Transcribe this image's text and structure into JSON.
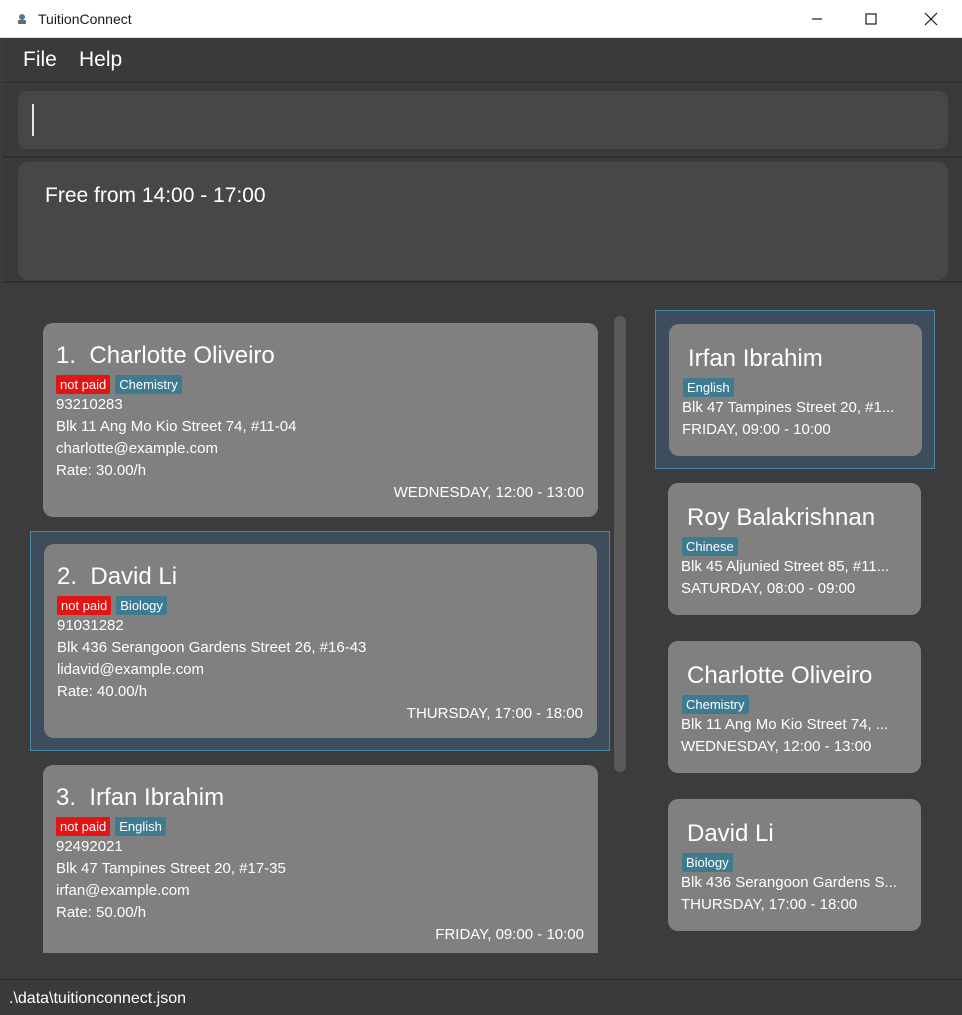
{
  "window": {
    "title": "TuitionConnect"
  },
  "menu": {
    "file": "File",
    "help": "Help"
  },
  "command": {
    "value": ""
  },
  "result": {
    "text": "Free from 14:00 - 17:00"
  },
  "students": [
    {
      "index": "1.",
      "name": "Charlotte Oliveiro",
      "paid": "not paid",
      "subject": "Chemistry",
      "phone": "93210283",
      "address": "Blk 11 Ang Mo Kio Street 74, #11-04",
      "email": "charlotte@example.com",
      "rate": "Rate: 30.00/h",
      "lesson": "WEDNESDAY, 12:00 - 13:00"
    },
    {
      "index": "2.",
      "name": "David Li",
      "paid": "not paid",
      "subject": "Biology",
      "phone": "91031282",
      "address": "Blk 436 Serangoon Gardens Street 26, #16-43",
      "email": "lidavid@example.com",
      "rate": "Rate: 40.00/h",
      "lesson": "THURSDAY, 17:00 - 18:00"
    },
    {
      "index": "3.",
      "name": "Irfan Ibrahim",
      "paid": "not paid",
      "subject": "English",
      "phone": "92492021",
      "address": "Blk 47 Tampines Street 20, #17-35",
      "email": "irfan@example.com",
      "rate": "Rate: 50.00/h",
      "lesson": "FRIDAY, 09:00 - 10:00"
    }
  ],
  "schedule": [
    {
      "name": "Irfan Ibrahim",
      "subject": "English",
      "address": "Blk 47 Tampines Street 20, #1...",
      "lesson": "FRIDAY, 09:00 - 10:00"
    },
    {
      "name": "Roy Balakrishnan",
      "subject": "Chinese",
      "address": "Blk 45 Aljunied Street 85, #11...",
      "lesson": "SATURDAY, 08:00 - 09:00"
    },
    {
      "name": "Charlotte Oliveiro",
      "subject": "Chemistry",
      "address": "Blk 11 Ang Mo Kio Street 74, ...",
      "lesson": "WEDNESDAY, 12:00 - 13:00"
    },
    {
      "name": "David Li",
      "subject": "Biology",
      "address": "Blk 436 Serangoon Gardens S...",
      "lesson": "THURSDAY, 17:00 - 18:00"
    }
  ],
  "status": {
    "path": ".\\data\\tuitionconnect.json"
  },
  "colors": {
    "not_paid": "#e31414",
    "subject_tag": "#3e7b91",
    "card": "#808080",
    "selection": "#3d4d5e"
  },
  "icons": {
    "app": "app-icon",
    "minimize": "minimize-icon",
    "maximize": "maximize-icon",
    "close": "close-icon"
  }
}
